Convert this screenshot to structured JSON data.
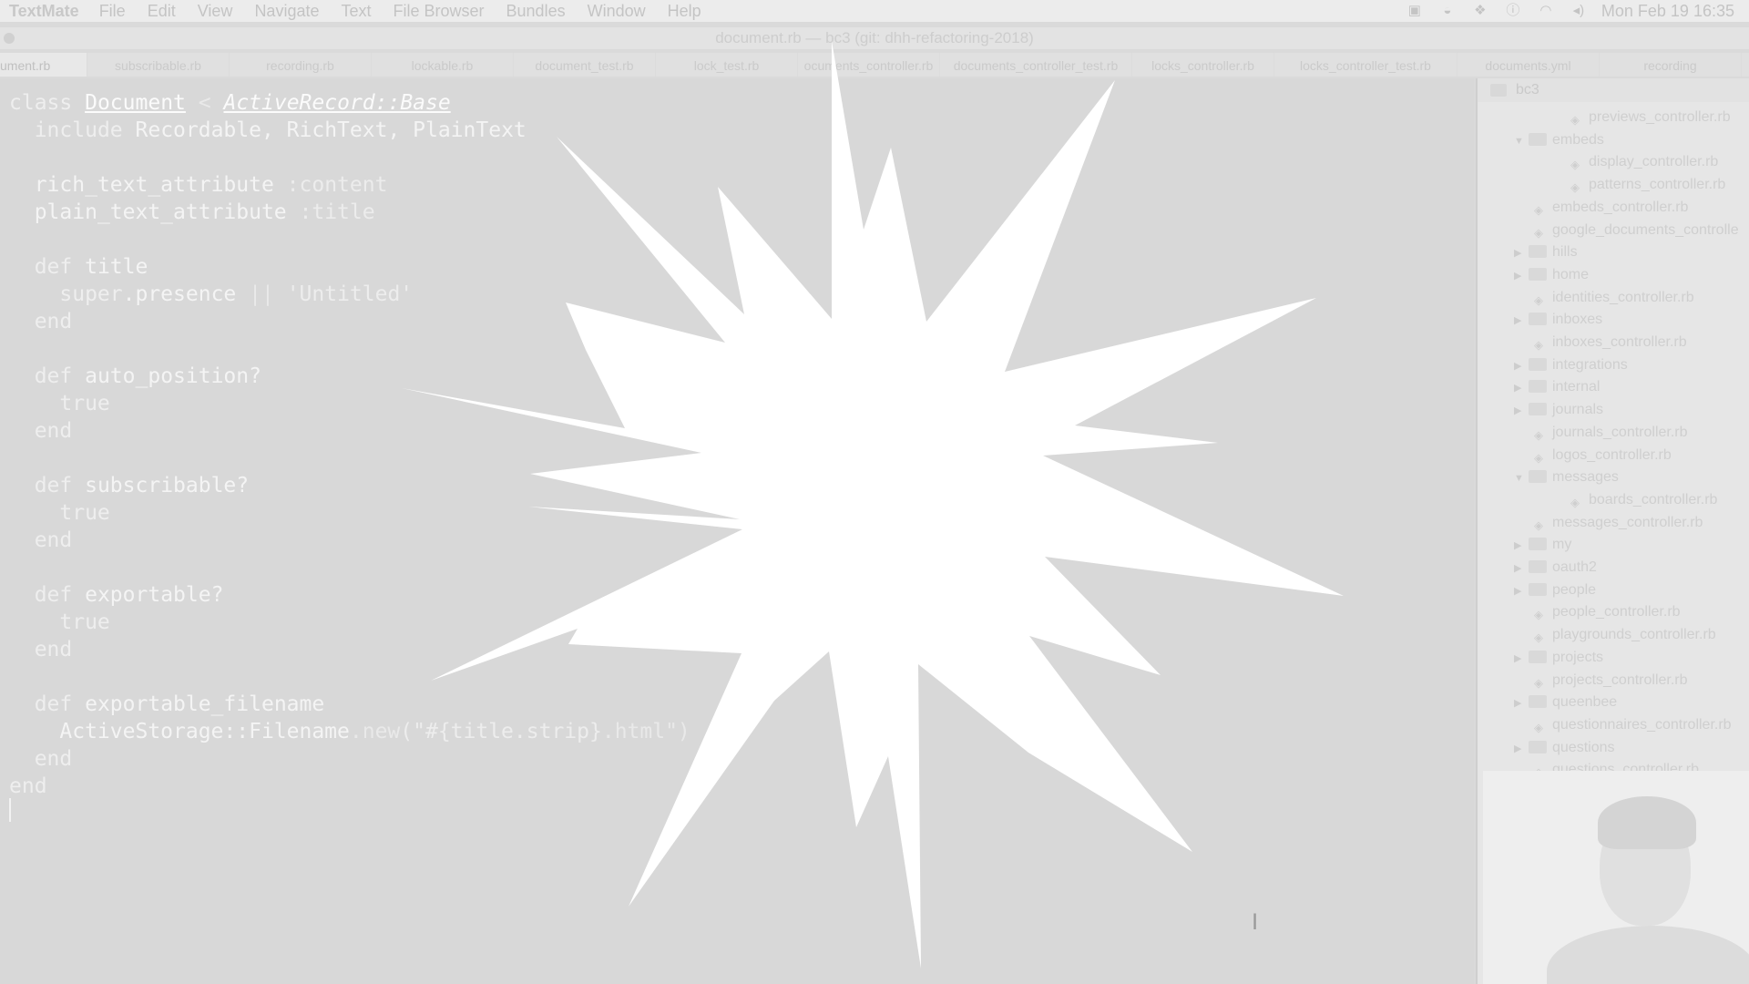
{
  "menubar": {
    "app_name": "TextMate",
    "items": [
      "File",
      "Edit",
      "View",
      "Navigate",
      "Text",
      "File Browser",
      "Bundles",
      "Window",
      "Help"
    ],
    "clock": "Mon Feb 19  16:35",
    "status_icons": [
      "screen-record-icon",
      "docker-icon",
      "dropbox-icon",
      "onepassword-icon",
      "wifi-icon",
      "volume-icon"
    ]
  },
  "window": {
    "title": "document.rb — bc3 (git: dhh-refactoring-2018)"
  },
  "tabs": [
    "ument.rb",
    "subscribable.rb",
    "recording.rb",
    "lockable.rb",
    "document_test.rb",
    "lock_test.rb",
    "ocuments_controller.rb",
    "documents_controller_test.rb",
    "locks_controller.rb",
    "locks_controller_test.rb",
    "documents.yml",
    "recording"
  ],
  "code": {
    "l1": {
      "kw": "class",
      "cls": "Document",
      "op": "<",
      "sup": "ActiveRecord::Base"
    },
    "l2": {
      "kw": "include",
      "rest": "Recordable, RichText, PlainText"
    },
    "l3": {
      "name": "rich_text_attribute",
      "sym": ":content"
    },
    "l4": {
      "name": "plain_text_attribute",
      "sym": ":title"
    },
    "l5": {
      "kw": "def",
      "name": "title"
    },
    "l6": {
      "kw": "super",
      "rest": ".presence",
      "op": "||",
      "str": "'Untitled'"
    },
    "l7": "end",
    "l8": {
      "kw": "def",
      "name": "auto_position?"
    },
    "l9": "true",
    "l10": "end",
    "l11": {
      "kw": "def",
      "name": "subscribable?"
    },
    "l12": "true",
    "l13": "end",
    "l14": {
      "kw": "def",
      "name": "exportable?"
    },
    "l15": "true",
    "l16": "end",
    "l17": {
      "kw": "def",
      "name": "exportable_filename"
    },
    "l18": {
      "a": "ActiveStorage::Filename",
      "b": ".new",
      "c": "(\"#{title.strip}",
      "d": ".html\")"
    },
    "l19": "end",
    "l20": "end"
  },
  "sidebar": {
    "root": "bc3",
    "rows": [
      {
        "type": "file",
        "label": "previews_controller.rb"
      },
      {
        "type": "folder-open",
        "label": "embeds"
      },
      {
        "type": "file",
        "label": "display_controller.rb"
      },
      {
        "type": "file",
        "label": "patterns_controller.rb"
      },
      {
        "type": "file",
        "label": "embeds_controller.rb"
      },
      {
        "type": "file",
        "label": "google_documents_controlle"
      },
      {
        "type": "folder",
        "label": "hills"
      },
      {
        "type": "folder",
        "label": "home"
      },
      {
        "type": "file",
        "label": "identities_controller.rb"
      },
      {
        "type": "folder",
        "label": "inboxes"
      },
      {
        "type": "file",
        "label": "inboxes_controller.rb"
      },
      {
        "type": "folder",
        "label": "integrations"
      },
      {
        "type": "folder",
        "label": "internal"
      },
      {
        "type": "folder",
        "label": "journals"
      },
      {
        "type": "file",
        "label": "journals_controller.rb"
      },
      {
        "type": "file",
        "label": "logos_controller.rb"
      },
      {
        "type": "folder-open",
        "label": "messages"
      },
      {
        "type": "file",
        "label": "boards_controller.rb"
      },
      {
        "type": "file",
        "label": "messages_controller.rb"
      },
      {
        "type": "folder",
        "label": "my"
      },
      {
        "type": "folder",
        "label": "oauth2"
      },
      {
        "type": "folder",
        "label": "people"
      },
      {
        "type": "file",
        "label": "people_controller.rb"
      },
      {
        "type": "file",
        "label": "playgrounds_controller.rb"
      },
      {
        "type": "folder",
        "label": "projects"
      },
      {
        "type": "file",
        "label": "projects_controller.rb"
      },
      {
        "type": "folder",
        "label": "queenbee"
      },
      {
        "type": "file",
        "label": "questionnaires_controller.rb"
      },
      {
        "type": "folder",
        "label": "questions"
      },
      {
        "type": "file",
        "label": "questions_controller.rb"
      }
    ]
  },
  "colors": {
    "overlay": "#dadada",
    "burst": "#ffffff",
    "code_text": "#f4f4f4"
  }
}
